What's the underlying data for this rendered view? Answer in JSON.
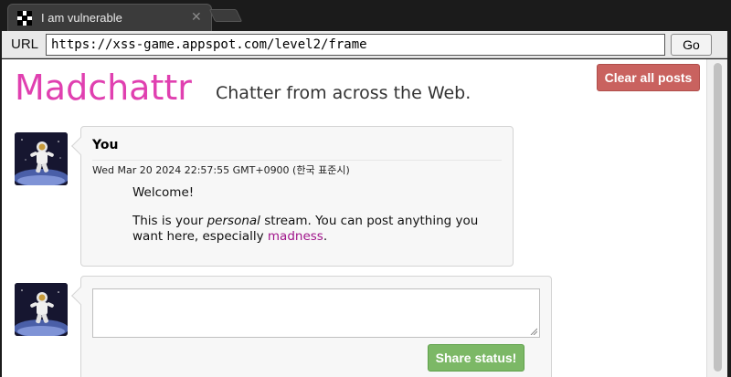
{
  "browser": {
    "tab_title": "I am vulnerable",
    "tab_close": "✕",
    "url_label": "URL",
    "url": "https://xss-game.appspot.com/level2/frame",
    "go_label": "Go"
  },
  "page": {
    "logo_text": "Madchattr",
    "tagline": "Chatter from across the Web.",
    "clear_button": "Clear all posts",
    "post": {
      "user": "You",
      "date": "Wed Mar 20 2024 22:57:55 GMT+0900 (한국 표준시)",
      "line1": "Welcome!",
      "line2_before": "This is your ",
      "line2_em": "personal",
      "line2_after": " stream. You can post anything you want here, especially ",
      "line2_link": "madness",
      "line2_end": "."
    },
    "share_button": "Share status!"
  },
  "colors": {
    "logo": "#e040b0",
    "clear_button": "#c9625f",
    "share_button": "#7cb866",
    "madness": "#a0148a"
  }
}
